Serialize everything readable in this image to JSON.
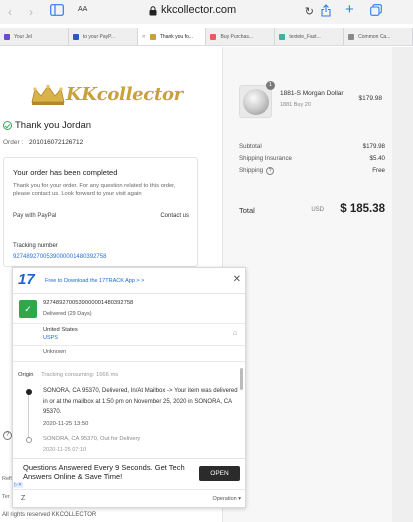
{
  "browser": {
    "address_aa": "AA",
    "url": "kkcollector.com"
  },
  "tabs": [
    {
      "label": "Your Jel",
      "fav_color": "#6a4bd8",
      "active": false
    },
    {
      "label": "to your PayP...",
      "fav_color": "#2a59c2",
      "active": false
    },
    {
      "label": "Thank you fo...",
      "fav_color": "#c9a13a",
      "active": true
    },
    {
      "label": "Buy Purchas...",
      "fav_color": "#e25c5c",
      "active": false
    },
    {
      "label": "textele_Fast...",
      "fav_color": "#3bb3a0",
      "active": false
    },
    {
      "label": "Common Ca...",
      "fav_color": "#8a8a8a",
      "active": false
    }
  ],
  "brand": {
    "name": "KKcollector",
    "color": "#c9a13a"
  },
  "confirmation": {
    "thanks": "Thank you Jordan",
    "order_label": "Order",
    "order_number": "201016072126712",
    "card_title": "Your order has been completed",
    "card_text": "Thank you for your order. For any question related to this order, please contact us. Look forward to your visit again",
    "pay_with": "Pay with PayPal",
    "contact_us": "Contact us",
    "tracking_label": "Tracking number",
    "tracking_number": "9274892700539000001480392758"
  },
  "left_side": {
    "refund_label": "Refl",
    "terms_label": "Ter",
    "help_icon": "?",
    "footer": "All rights reserved KKCOLLECTOR"
  },
  "summary": {
    "product_name": "1881-S Morgan Dollar",
    "product_sub": "1881 Buy 20",
    "product_price": "$179.98",
    "quantity": "1",
    "subtotal_label": "Subtotal",
    "subtotal_value": "$179.98",
    "shipping_insurance_label": "Shipping Insurance",
    "shipping_insurance_value": "$5.40",
    "shipping_label": "Shipping",
    "shipping_value": "Free",
    "total_label": "Total",
    "total_currency": "USD",
    "total_value": "$ 185.38"
  },
  "tracker": {
    "logo": "17",
    "download_text": "Free to Download the 17TRACK App > >",
    "tracking_number": "9274892700539000001480392758",
    "delivered": "Delivered (29 Days)",
    "country": "United States",
    "carrier": "USPS",
    "destination": "Unknown",
    "origin_label": "Origin",
    "origin_meta": "Tracking consuming: 1666 ms",
    "event1_text": "SONORA, CA 95370, Delivered, In/At Mailbox -> Your item was delivered in or at the mailbox at 1:50 pm on November 25, 2020 in SONORA, CA 95370.",
    "event1_time": "2020-11-25 13:50",
    "event2_text": "SONORA, CA 95370, Out for Delivery",
    "event2_time": "2020-11-25 07:10",
    "translate_icon": "Z",
    "operation": "Operation"
  },
  "ad": {
    "text": "Questions Answered Every 9 Seconds. Get Tech Answers Online & Save Time!",
    "button": "OPEN"
  }
}
